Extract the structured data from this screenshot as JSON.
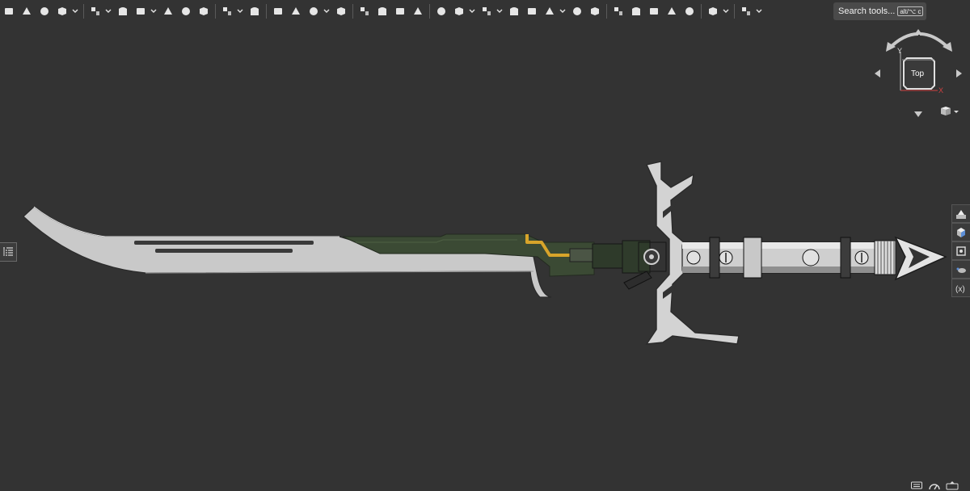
{
  "toolbar": {
    "groups": [
      [
        {
          "icon": "sketch-icon"
        },
        {
          "icon": "extrude-icon"
        },
        {
          "icon": "revolve-icon"
        },
        {
          "icon": "sweep-icon",
          "caret": true
        }
      ],
      [
        {
          "icon": "loft-icon",
          "caret": true
        },
        {
          "icon": "thicken-icon"
        },
        {
          "icon": "enclose-icon",
          "caret": true
        },
        {
          "icon": "fillet-icon"
        },
        {
          "icon": "chamfer-icon"
        },
        {
          "icon": "draft-icon"
        }
      ],
      [
        {
          "icon": "pattern-icon",
          "caret": true
        },
        {
          "icon": "mirror-icon"
        }
      ],
      [
        {
          "icon": "boolean-icon"
        },
        {
          "icon": "split-icon"
        },
        {
          "icon": "transform-icon",
          "caret": true
        },
        {
          "icon": "delete-part-icon"
        }
      ],
      [
        {
          "icon": "modify-fillet-icon"
        },
        {
          "icon": "shell-icon"
        },
        {
          "icon": "hole-icon"
        },
        {
          "icon": "thread-icon"
        }
      ],
      [
        {
          "icon": "plane-icon"
        },
        {
          "icon": "mate-connector-icon",
          "caret": true
        },
        {
          "icon": "variable-icon",
          "caret": true
        },
        {
          "icon": "section-icon"
        },
        {
          "icon": "helix-icon"
        },
        {
          "icon": "formula-icon",
          "caret": true
        },
        {
          "icon": "custom-feature-icon"
        },
        {
          "icon": "tag-icon"
        }
      ],
      [
        {
          "icon": "surface-icon"
        },
        {
          "icon": "assembly-icon"
        },
        {
          "icon": "sheet-metal-icon"
        },
        {
          "icon": "frame-icon"
        },
        {
          "icon": "replace-face-icon"
        }
      ],
      [
        {
          "icon": "render-studio-icon",
          "caret": true
        }
      ],
      [
        {
          "icon": "settings-gear-icon",
          "caret": true
        }
      ]
    ],
    "search": {
      "label": "Search tools...",
      "shortcut": "alt/⌥ c"
    }
  },
  "viewcube": {
    "face_label": "Top",
    "axis_x": "X",
    "axis_y": "Y"
  },
  "right_tools": [
    "appearance-icon",
    "parts-icon",
    "mates-icon",
    "measure-icon",
    "variables-icon"
  ],
  "bottom_tools": [
    "keyboard-icon",
    "gauge-icon",
    "orientation-icon"
  ],
  "colors": {
    "background": "#333333",
    "blade": "#c8c8c8",
    "green_plate": "#3a4a33",
    "handle": "#cfcfcf",
    "gold": "#d4a22a"
  }
}
